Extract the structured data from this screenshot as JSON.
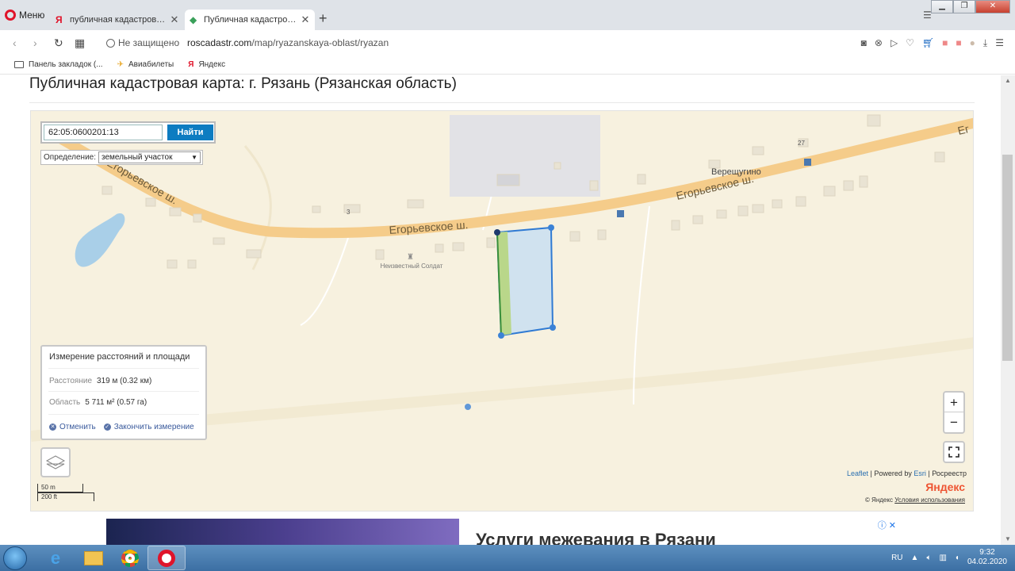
{
  "browser": {
    "menu_label": "Меню",
    "tabs": [
      {
        "title": "публичная кадастровая к",
        "active": false
      },
      {
        "title": "Публичная кадастровая к",
        "active": true
      }
    ],
    "new_tab": "+",
    "security_label": "Не защищено",
    "url_host": "roscadastr.com",
    "url_path": "/map/ryazanskaya-oblast/ryazan",
    "bookmarks": [
      {
        "label": "Панель закладок (..."
      },
      {
        "label": "Авиабилеты"
      },
      {
        "label": "Яндекс"
      }
    ]
  },
  "page": {
    "title": "Публичная кадастровая карта: г. Рязань (Рязанская область)"
  },
  "map": {
    "search_value": "62:05:0600201:13",
    "search_button": "Найти",
    "definition_label": "Определение:",
    "definition_value": "земельный участок",
    "road_labels": [
      "Егорьевское ш.",
      "Егорьевское ш.",
      "Егорьевское ш."
    ],
    "edge_label": "Ег",
    "place_label": "Верещугино",
    "house_numbers": [
      "3",
      "27"
    ],
    "monument_label": "Неизвестный Солдат",
    "zoom_in": "+",
    "zoom_out": "−",
    "attribution": {
      "leaflet": "Leaflet",
      "powered": "Powered by",
      "esri": "Esri",
      "rosreestr": "Росреестр"
    },
    "yandex_logo": "Яндекс",
    "yandex_copy": "© Яндекс",
    "yandex_terms": "Условия использования",
    "scale_metric": "50 m",
    "scale_imperial": "200 ft",
    "colors": {
      "road": "#f5cc8a",
      "parcel_fill": "#c9dff2",
      "parcel_stroke": "#2f7ad3",
      "strip": "#b9d78a",
      "water": "#a9cfe8",
      "background": "#f7f1df"
    }
  },
  "measure": {
    "heading": "Измерение расстояний и площади",
    "distance_label": "Расстояние",
    "distance_value": "319 м (0.32 км)",
    "area_label": "Область",
    "area_value": "5 711 м² (0.57 га)",
    "cancel": "Отменить",
    "finish": "Закончить измерение"
  },
  "ad": {
    "headline": "Услуги межевания в Рязани"
  },
  "taskbar": {
    "lang": "RU",
    "time": "9:32",
    "date": "04.02.2020"
  }
}
